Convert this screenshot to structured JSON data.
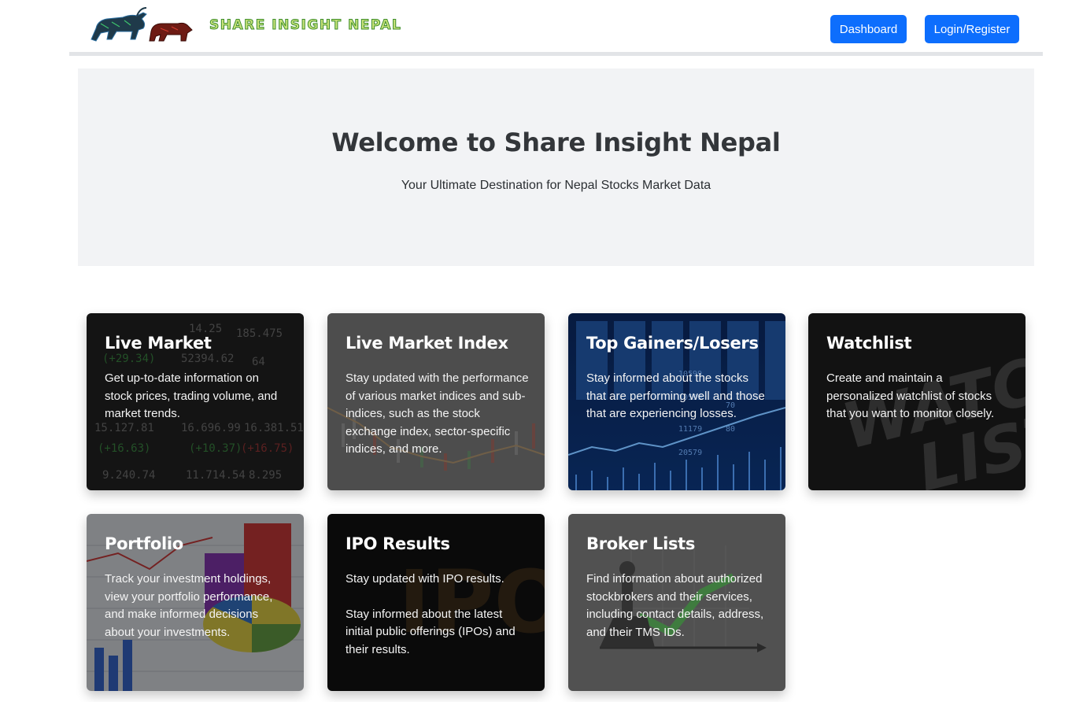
{
  "header": {
    "brand": "Share Insight Nepal",
    "dashboard_label": "Dashboard",
    "login_label": "Login/Register"
  },
  "hero": {
    "title": "Welcome to Share Insight Nepal",
    "subtitle": "Your Ultimate Destination for Nepal Stocks Market Data"
  },
  "cards": [
    {
      "title": "Live Market",
      "text": "Get up-to-date information on stock prices, trading volume, and market trends."
    },
    {
      "title": "Live Market Index",
      "text": "Stay updated with the performance of various market indices and sub-indices, such as the stock exchange index, sector-specific indices, and more."
    },
    {
      "title": "Top Gainers/Losers",
      "text": "Stay informed about the stocks that are performing well and those that are experiencing losses."
    },
    {
      "title": "Watchlist",
      "text": "Create and maintain a personalized watchlist of stocks that you want to monitor closely."
    },
    {
      "title": "Portfolio",
      "text": "Track your investment holdings, view your portfolio performance, and make informed decisions about your investments."
    },
    {
      "title": "IPO Results",
      "text": "Stay updated with IPO results.",
      "text2": "Stay informed about the latest initial public offerings (IPOs) and their results."
    },
    {
      "title": "Broker Lists",
      "text": "Find information about authorized stockbrokers and their services, including contact details, address, and their TMS IDs."
    }
  ],
  "colors": {
    "primary": "#0d6efd",
    "hero_bg": "#f2f3f5",
    "nav_border": "#e2e4e7"
  }
}
